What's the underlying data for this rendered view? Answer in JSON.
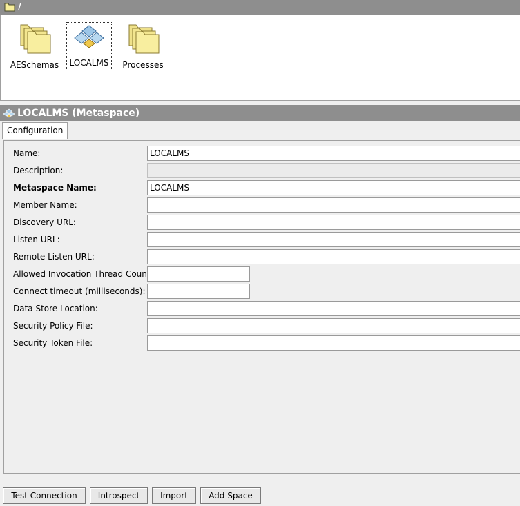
{
  "topbar": {
    "path": "/"
  },
  "browser": {
    "items": [
      {
        "label": "AESchemas",
        "icon": "folder-stack-icon"
      },
      {
        "label": "LOCALMS",
        "icon": "metaspace-icon",
        "selected": true
      },
      {
        "label": "Processes",
        "icon": "folder-stack-icon"
      }
    ]
  },
  "header": {
    "title": "LOCALMS (Metaspace)",
    "icon": "metaspace-icon"
  },
  "tabs": {
    "configuration": "Configuration"
  },
  "form": {
    "name": {
      "label": "Name:",
      "value": "LOCALMS"
    },
    "description": {
      "label": "Description:",
      "value": ""
    },
    "metaspace_name": {
      "label": "Metaspace Name:",
      "value": "LOCALMS"
    },
    "member_name": {
      "label": "Member Name:",
      "value": ""
    },
    "discovery_url": {
      "label": "Discovery URL:",
      "value": ""
    },
    "listen_url": {
      "label": "Listen URL:",
      "value": ""
    },
    "remote_listen_url": {
      "label": "Remote Listen URL:",
      "value": ""
    },
    "thread_count": {
      "label": "Allowed Invocation Thread Count:",
      "value": ""
    },
    "connect_timeout": {
      "label": "Connect timeout (milliseconds):",
      "value": ""
    },
    "data_store_location": {
      "label": "Data Store Location:",
      "value": ""
    },
    "security_policy_file": {
      "label": "Security Policy File:",
      "value": ""
    },
    "security_token_file": {
      "label": "Security Token File:",
      "value": ""
    }
  },
  "buttons": {
    "test_connection": "Test Connection",
    "introspect": "Introspect",
    "import": "Import",
    "add_space": "Add Space"
  },
  "colors": {
    "title_bar": "#8e8e8e",
    "folder": "#f5e88a",
    "panel": "#efefef"
  }
}
